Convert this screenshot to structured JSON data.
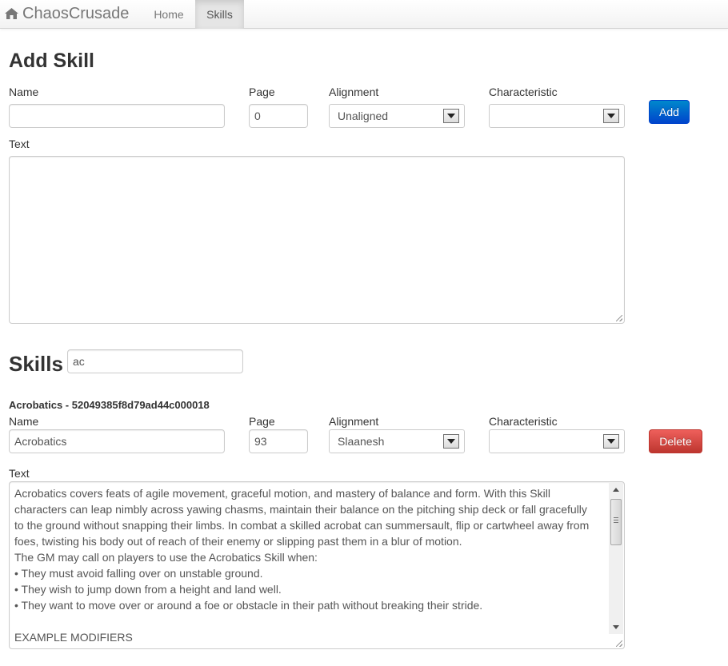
{
  "navbar": {
    "brand": "ChaosCrusade",
    "items": [
      {
        "label": "Home",
        "active": false
      },
      {
        "label": "Skills",
        "active": true
      }
    ]
  },
  "add_skill": {
    "heading": "Add Skill",
    "name_label": "Name",
    "name_value": "",
    "page_label": "Page",
    "page_value": "0",
    "alignment_label": "Alignment",
    "alignment_value": "Unaligned",
    "characteristic_label": "Characteristic",
    "characteristic_value": "",
    "text_label": "Text",
    "text_value": "",
    "add_button": "Add"
  },
  "skills": {
    "heading": "Skills",
    "filter_value": "ac",
    "items": [
      {
        "title": "Acrobatics - 52049385f8d79ad44c000018",
        "name_label": "Name",
        "name_value": "Acrobatics",
        "page_label": "Page",
        "page_value": "93",
        "alignment_label": "Alignment",
        "alignment_value": "Slaanesh",
        "characteristic_label": "Characteristic",
        "characteristic_value": "",
        "delete_button": "Delete",
        "text_label": "Text",
        "text_lines": [
          "Acrobatics covers feats of agile movement, graceful motion, and mastery of balance and form. With this Skill",
          "characters can leap nimbly across yawing chasms, maintain their balance on the pitching ship deck or fall gracefully",
          "to the ground without snapping their limbs. In combat a skilled acrobat can summersault, flip or cartwheel away from",
          "foes, twisting his body out of reach of their enemy or slipping past them in a blur of motion.",
          "The GM may call on players to use the Acrobatics Skill when:",
          "•  They must avoid falling over on unstable ground.",
          "•  They wish to jump down from a height and land well.",
          "•  They want to move over or around a foe or obstacle in their path without breaking their stride.",
          "",
          "EXAMPLE  MODIFIERS"
        ]
      }
    ]
  },
  "colors": {
    "primary": "#0088cc",
    "danger": "#da4f49"
  }
}
